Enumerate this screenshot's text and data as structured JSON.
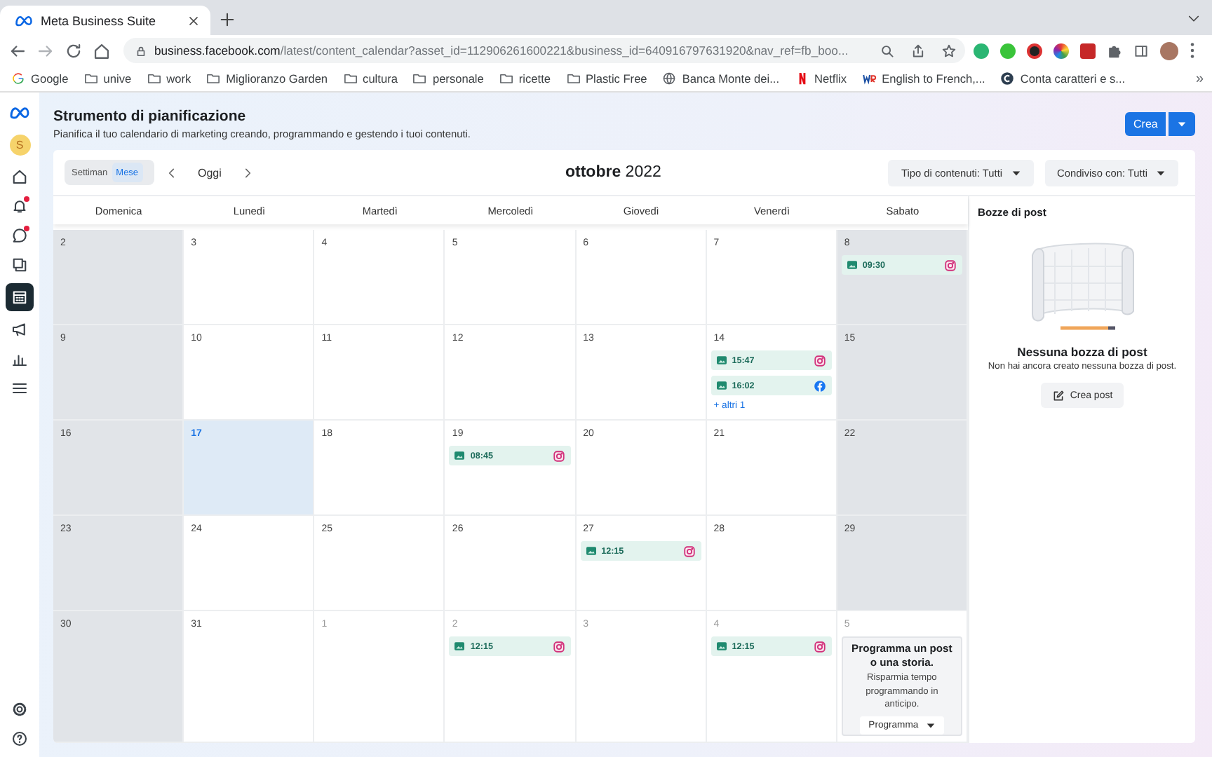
{
  "browser": {
    "tab_title": "Meta Business Suite",
    "url": "**business.facebook.com**/latest/content_calendar?asset_id=112906261600221&business_id=640916797631920&nav_ref=fb_boo...",
    "bookmarks": [
      {
        "kind": "google",
        "label": "Google"
      },
      {
        "kind": "folder",
        "label": "unive"
      },
      {
        "kind": "folder",
        "label": "work"
      },
      {
        "kind": "folder",
        "label": "Miglioranzo Garden"
      },
      {
        "kind": "folder",
        "label": "cultura"
      },
      {
        "kind": "folder",
        "label": "personale"
      },
      {
        "kind": "folder",
        "label": "ricette"
      },
      {
        "kind": "folder",
        "label": "Plastic Free"
      },
      {
        "kind": "globe",
        "label": "Banca Monte dei..."
      },
      {
        "kind": "netflix",
        "label": "Netflix"
      },
      {
        "kind": "wr",
        "label": "English to French,..."
      },
      {
        "kind": "c",
        "label": "Conta caratteri e s..."
      }
    ],
    "more": "»"
  },
  "sidebar": {
    "avatar": "S",
    "items": [
      {
        "kind": "home",
        "selected": false,
        "badge": false
      },
      {
        "kind": "bell",
        "selected": false,
        "badge": true
      },
      {
        "kind": "chat",
        "selected": false,
        "badge": true
      },
      {
        "kind": "pages",
        "selected": false,
        "badge": false
      },
      {
        "kind": "calendar",
        "selected": true,
        "badge": false
      },
      {
        "kind": "megaphone",
        "selected": false,
        "badge": false
      },
      {
        "kind": "chart",
        "selected": false,
        "badge": false
      },
      {
        "kind": "menu",
        "selected": false,
        "badge": false
      }
    ],
    "bottom": [
      {
        "kind": "settings"
      },
      {
        "kind": "help"
      }
    ]
  },
  "header": {
    "title": "Strumento di pianificazione",
    "subtitle": "Pianifica il tuo calendario di marketing creando, programmando e gestendo i tuoi contenuti.",
    "create_button": "Crea"
  },
  "toolbar": {
    "views": [
      {
        "label": "Settiman",
        "selected": false
      },
      {
        "label": "Mese",
        "selected": true
      }
    ],
    "today": "Oggi",
    "month": "**ottobre** 2022",
    "filters": [
      "Tipo di contenuti: Tutti",
      "Condiviso con: Tutti"
    ]
  },
  "calendar": {
    "weekdays": [
      "Domenica",
      "Lunedì",
      "Martedì",
      "Mercoledì",
      "Giovedì",
      "Venerdì",
      "Sabato"
    ],
    "weeks": [
      [
        {
          "day": "2",
          "in_month": true,
          "shaded": true,
          "today": false
        },
        {
          "day": "3",
          "in_month": true,
          "shaded": false,
          "today": false
        },
        {
          "day": "4",
          "in_month": true,
          "shaded": false,
          "today": false
        },
        {
          "day": "5",
          "in_month": true,
          "shaded": false,
          "today": false
        },
        {
          "day": "6",
          "in_month": true,
          "shaded": false,
          "today": false
        },
        {
          "day": "7",
          "in_month": true,
          "shaded": false,
          "today": false
        },
        {
          "day": "8",
          "in_month": true,
          "shaded": true,
          "today": false,
          "events": [
            {
              "time": "09:30",
              "kind": "instagram"
            }
          ]
        }
      ],
      [
        {
          "day": "9",
          "in_month": true,
          "shaded": true,
          "today": false
        },
        {
          "day": "10",
          "in_month": true,
          "shaded": false,
          "today": false
        },
        {
          "day": "11",
          "in_month": true,
          "shaded": false,
          "today": false
        },
        {
          "day": "12",
          "in_month": true,
          "shaded": false,
          "today": false
        },
        {
          "day": "13",
          "in_month": true,
          "shaded": false,
          "today": false
        },
        {
          "day": "14",
          "in_month": true,
          "shaded": false,
          "today": false,
          "events": [
            {
              "time": "15:47",
              "kind": "instagram"
            },
            {
              "time": "16:02",
              "kind": "facebook"
            }
          ],
          "more": "+ altri 1"
        },
        {
          "day": "15",
          "in_month": true,
          "shaded": true,
          "today": false
        }
      ],
      [
        {
          "day": "16",
          "in_month": true,
          "shaded": true,
          "today": false
        },
        {
          "day": "17",
          "in_month": true,
          "shaded": false,
          "today": true
        },
        {
          "day": "18",
          "in_month": true,
          "shaded": false,
          "today": false
        },
        {
          "day": "19",
          "in_month": true,
          "shaded": false,
          "today": false,
          "events": [
            {
              "time": "08:45",
              "kind": "instagram"
            }
          ]
        },
        {
          "day": "20",
          "in_month": true,
          "shaded": false,
          "today": false
        },
        {
          "day": "21",
          "in_month": true,
          "shaded": false,
          "today": false
        },
        {
          "day": "22",
          "in_month": true,
          "shaded": true,
          "today": false
        }
      ],
      [
        {
          "day": "23",
          "in_month": true,
          "shaded": true,
          "today": false
        },
        {
          "day": "24",
          "in_month": true,
          "shaded": false,
          "today": false
        },
        {
          "day": "25",
          "in_month": true,
          "shaded": false,
          "today": false
        },
        {
          "day": "26",
          "in_month": true,
          "shaded": false,
          "today": false
        },
        {
          "day": "27",
          "in_month": true,
          "shaded": false,
          "today": false,
          "events": [
            {
              "time": "12:15",
              "kind": "instagram"
            }
          ]
        },
        {
          "day": "28",
          "in_month": true,
          "shaded": false,
          "today": false
        },
        {
          "day": "29",
          "in_month": true,
          "shaded": true,
          "today": false
        }
      ],
      [
        {
          "day": "30",
          "in_month": true,
          "shaded": true,
          "today": false
        },
        {
          "day": "31",
          "in_month": true,
          "shaded": false,
          "today": false
        },
        {
          "day": "1",
          "in_month": false,
          "shaded": false,
          "today": false
        },
        {
          "day": "2",
          "in_month": false,
          "shaded": false,
          "today": false,
          "events": [
            {
              "time": "12:15",
              "kind": "instagram"
            }
          ]
        },
        {
          "day": "3",
          "in_month": false,
          "shaded": false,
          "today": false
        },
        {
          "day": "4",
          "in_month": false,
          "shaded": false,
          "today": false,
          "events": [
            {
              "time": "12:15",
              "kind": "instagram"
            }
          ]
        },
        {
          "day": "5",
          "in_month": false,
          "shaded": false,
          "today": false,
          "promo": {
            "title": "Programma un post o una storia.",
            "text": "Risparmia tempo programmando in anticipo.",
            "button": "Programma"
          }
        }
      ]
    ]
  },
  "drafts": {
    "title": "Bozze di post",
    "empty_title": "Nessuna bozza di post",
    "empty_text": "Non hai ancora creato nessuna bozza di post.",
    "button": "Crea post"
  }
}
